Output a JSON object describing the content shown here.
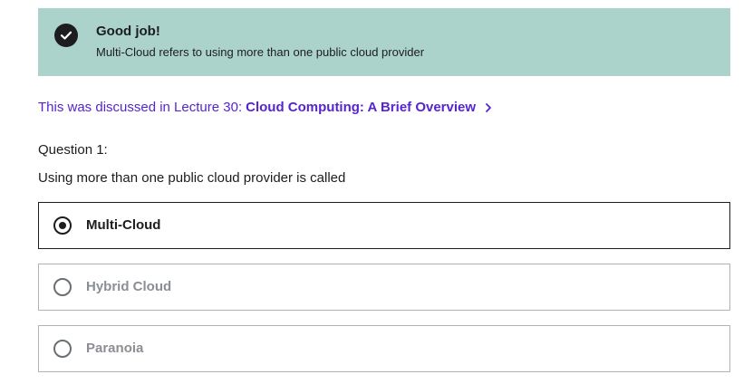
{
  "feedback": {
    "icon": "check-circle-icon",
    "title": "Good job!",
    "message": "Multi-Cloud refers to using more than one public cloud provider",
    "background_color": "#acd2cc"
  },
  "lecture_reference": {
    "prefix": "This was discussed in Lecture 30:",
    "title": "Cloud Computing: A Brief Overview",
    "icon": "chevron-right-icon",
    "color": "#5624d0"
  },
  "question": {
    "number_label": "Question 1:",
    "text": "Using more than one public cloud provider is called"
  },
  "options": [
    {
      "label": "Multi-Cloud",
      "selected": true
    },
    {
      "label": "Hybrid Cloud",
      "selected": false
    },
    {
      "label": "Paranoia",
      "selected": false
    }
  ]
}
